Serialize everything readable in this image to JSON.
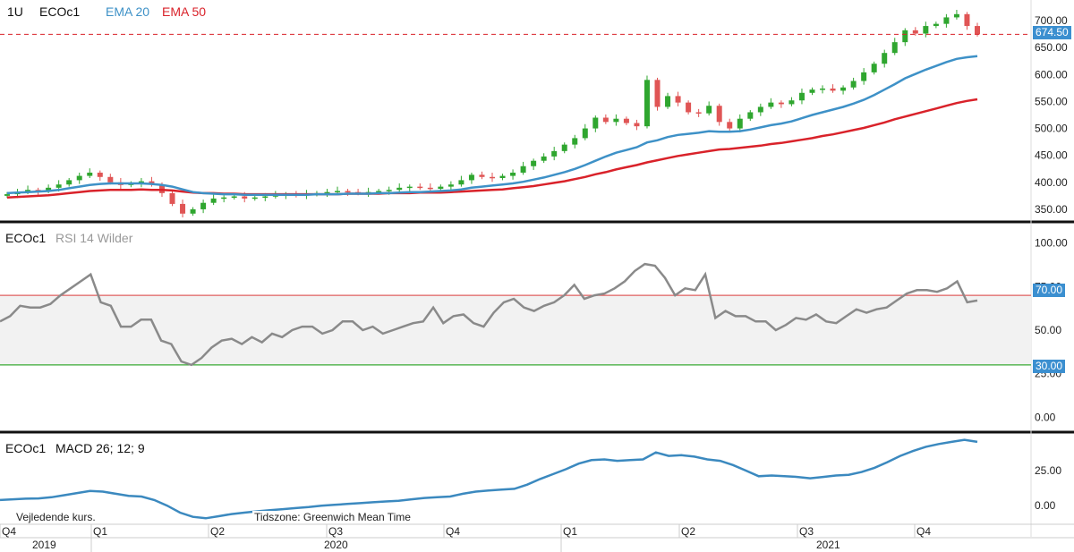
{
  "header": {
    "interval": "1U",
    "symbol": "ECOc1",
    "ema20_label": "EMA 20",
    "ema50_label": "EMA 50",
    "rsi_symbol": "ECOc1",
    "rsi_label": "RSI 14 Wilder",
    "macd_symbol": "ECOc1",
    "macd_label": "MACD 26; 12; 9"
  },
  "footer": {
    "note_left": "Vejledende kurs.",
    "timezone": "Tidszone: Greenwich Mean Time"
  },
  "colors": {
    "up": "#2fa62f",
    "down": "#e05555",
    "ema20": "#3e91c7",
    "ema50": "#d9222a",
    "rsi": "#8a8a8a",
    "macd": "#3b89bf",
    "price_tag": "#3b8fd0"
  },
  "chart_data": [
    {
      "type": "candlestick",
      "last_price_label": "674.50",
      "last_price": 674.5,
      "ylim": [
        330,
        715
      ],
      "yticks": [
        "700.00",
        "650.00",
        "600.00",
        "550.00",
        "500.00",
        "450.00",
        "400.00",
        "350.00"
      ],
      "ytick_values": [
        700,
        650,
        600,
        550,
        500,
        450,
        400,
        350
      ],
      "ohlc_close_series": [
        378,
        382,
        386,
        384,
        390,
        396,
        404,
        412,
        418,
        410,
        400,
        395,
        398,
        402,
        396,
        380,
        360,
        342,
        350,
        362,
        370,
        372,
        374,
        370,
        372,
        374,
        376,
        378,
        376,
        378,
        380,
        382,
        384,
        382,
        380,
        382,
        384,
        386,
        390,
        392,
        390,
        388,
        392,
        396,
        404,
        414,
        410,
        408,
        412,
        418,
        430,
        440,
        448,
        458,
        470,
        482,
        500,
        520,
        512,
        518,
        510,
        504,
        590,
        540,
        560,
        548,
        530,
        528,
        542,
        512,
        500,
        518,
        530,
        540,
        548,
        545,
        552,
        566,
        572,
        574,
        570,
        576,
        588,
        604,
        620,
        640,
        660,
        682,
        676,
        690,
        694,
        706,
        712,
        690,
        674.5
      ],
      "ema20_values": [
        380,
        381,
        382,
        383,
        384,
        386,
        389,
        392,
        395,
        397,
        398,
        398,
        398,
        398,
        397,
        395,
        392,
        387,
        382,
        380,
        379,
        378,
        378,
        377,
        377,
        377,
        377,
        377,
        377,
        377,
        378,
        378,
        378,
        379,
        379,
        379,
        380,
        380,
        381,
        382,
        382,
        383,
        384,
        385,
        387,
        390,
        392,
        394,
        396,
        398,
        401,
        405,
        409,
        414,
        419,
        425,
        432,
        440,
        448,
        455,
        460,
        465,
        474,
        478,
        484,
        488,
        490,
        492,
        495,
        494,
        494,
        495,
        498,
        502,
        506,
        509,
        513,
        519,
        525,
        530,
        535,
        540,
        546,
        553,
        562,
        572,
        582,
        593,
        601,
        609,
        616,
        623,
        629,
        632,
        634
      ],
      "ema50_values": [
        372,
        373,
        374,
        375,
        376,
        378,
        380,
        382,
        384,
        385,
        386,
        386,
        386,
        387,
        386,
        386,
        385,
        383,
        381,
        380,
        380,
        379,
        379,
        378,
        378,
        378,
        378,
        378,
        378,
        378,
        378,
        378,
        378,
        379,
        379,
        379,
        379,
        380,
        380,
        380,
        381,
        381,
        381,
        382,
        383,
        384,
        385,
        386,
        387,
        389,
        391,
        393,
        396,
        399,
        402,
        406,
        410,
        415,
        419,
        424,
        428,
        432,
        437,
        441,
        445,
        449,
        452,
        455,
        458,
        461,
        462,
        464,
        466,
        468,
        471,
        473,
        476,
        479,
        482,
        486,
        489,
        493,
        497,
        501,
        506,
        511,
        517,
        522,
        527,
        532,
        537,
        542,
        547,
        551,
        554
      ],
      "x_quarters": [
        "Q4",
        "Q1",
        "Q2",
        "Q3",
        "Q4",
        "Q1",
        "Q2",
        "Q3",
        "Q4"
      ],
      "x_years": [
        "2019",
        "2020",
        "2021"
      ]
    },
    {
      "type": "line",
      "title": "RSI 14 Wilder",
      "ylim": [
        -5,
        105
      ],
      "yticks": [
        "100.00",
        "75.00",
        "50.00",
        "25.00",
        "0.00"
      ],
      "ytick_values": [
        100,
        75,
        50,
        25,
        0
      ],
      "reference_lines": [
        {
          "value": 70,
          "label": "70.00",
          "color": "#e06060"
        },
        {
          "value": 30,
          "label": "30.00",
          "color": "#3aaa35"
        }
      ],
      "values": [
        55,
        58,
        64,
        63,
        63,
        65,
        70,
        74,
        78,
        82,
        66,
        64,
        52,
        52,
        56,
        56,
        44,
        42,
        32,
        30,
        34,
        40,
        44,
        45,
        42,
        46,
        43,
        48,
        46,
        50,
        52,
        52,
        48,
        50,
        55,
        55,
        50,
        52,
        48,
        50,
        52,
        54,
        55,
        63,
        54,
        58,
        59,
        54,
        52,
        60,
        66,
        68,
        63,
        61,
        64,
        66,
        70,
        76,
        68,
        70,
        71,
        74,
        78,
        84,
        88,
        87,
        80,
        70,
        74,
        73,
        82,
        57,
        61,
        58,
        58,
        55,
        55,
        50,
        53,
        57,
        56,
        59,
        55,
        54,
        58,
        62,
        60,
        62,
        63,
        67,
        71,
        73,
        73,
        72,
        74,
        78,
        66,
        67
      ]
    },
    {
      "type": "line",
      "title": "MACD 26; 12; 9",
      "ylim": [
        -12,
        48
      ],
      "yticks": [
        "25.00",
        "0.00"
      ],
      "ytick_values": [
        25,
        0
      ],
      "values": [
        4,
        4.5,
        5,
        5.2,
        6,
        7.5,
        9,
        10.5,
        10,
        8.5,
        7,
        6.5,
        4,
        0,
        -5,
        -8,
        -9,
        -7.5,
        -6,
        -5,
        -4,
        -3.2,
        -2.5,
        -1.7,
        -1,
        0,
        0.6,
        1.2,
        1.8,
        2.4,
        3,
        3.5,
        4.5,
        5.5,
        6,
        6.5,
        8.5,
        10,
        10.8,
        11.5,
        12,
        15,
        19,
        22.5,
        26,
        30,
        32.5,
        33,
        32,
        32.5,
        33,
        38,
        35.5,
        36,
        35,
        33,
        32,
        29,
        25,
        21,
        21.5,
        21,
        20.5,
        19.5,
        20.5,
        21.5,
        22,
        24,
        27,
        31,
        35.5,
        39,
        42,
        44,
        45.5,
        47,
        45.5
      ]
    }
  ]
}
